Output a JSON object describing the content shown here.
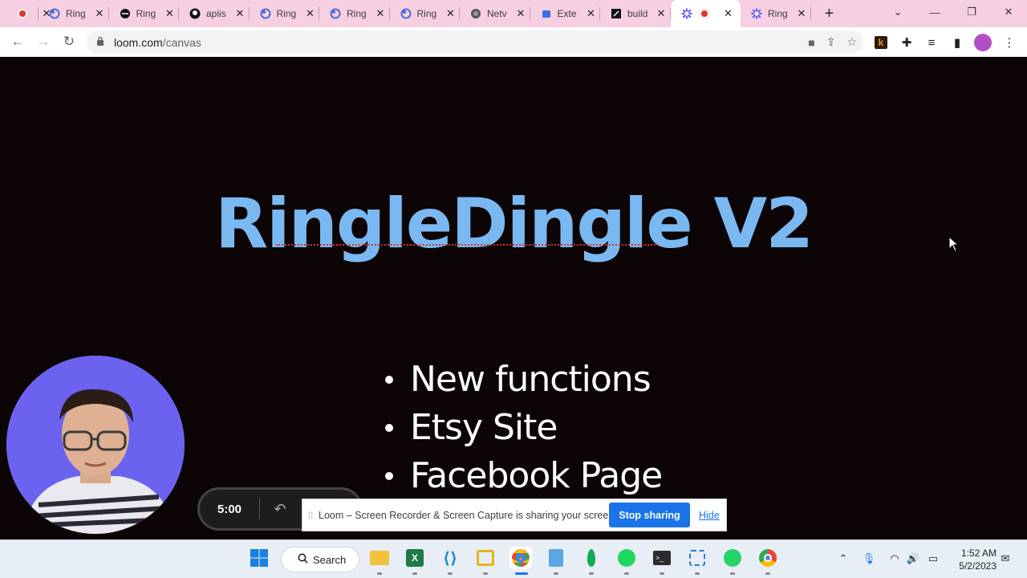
{
  "browser": {
    "tabs": [
      {
        "title": "",
        "icon": "recording-icon",
        "active": false
      },
      {
        "title": "Ring",
        "icon": "ring-app-icon",
        "active": false
      },
      {
        "title": "Ring",
        "icon": "ring-dark-icon",
        "active": false
      },
      {
        "title": "apiis",
        "icon": "github-icon",
        "active": false
      },
      {
        "title": "Ring",
        "icon": "ring-app-icon",
        "active": false
      },
      {
        "title": "Ring",
        "icon": "ring-app-icon",
        "active": false
      },
      {
        "title": "Ring",
        "icon": "ring-app-icon",
        "active": false
      },
      {
        "title": "Netv",
        "icon": "brain-icon",
        "active": false
      },
      {
        "title": "Exte",
        "icon": "puzzle-icon",
        "active": false
      },
      {
        "title": "build",
        "icon": "build-icon",
        "active": false
      },
      {
        "title": "",
        "icon": "loom-icon",
        "active": true
      },
      {
        "title": "Ring",
        "icon": "loom-icon",
        "active": false
      }
    ],
    "url_host": "loom.com",
    "url_path": "/canvas"
  },
  "slide": {
    "title": "RingleDingle V2",
    "bullets": [
      "New functions",
      "Etsy Site",
      "Facebook Page"
    ]
  },
  "loom": {
    "timer": "5:00",
    "share_message": "Loom – Screen Recorder & Screen Capture is sharing your screen.",
    "stop_label": "Stop sharing",
    "hide_label": "Hide"
  },
  "taskbar": {
    "search_label": "Search",
    "time": "1:52 AM",
    "date": "5/2/2023"
  },
  "colors": {
    "tab_strip": "#f7cfe2",
    "title_blue": "#7ab8f2",
    "camera_bg": "#6b63f0",
    "stop_button": "#1a73e8"
  }
}
